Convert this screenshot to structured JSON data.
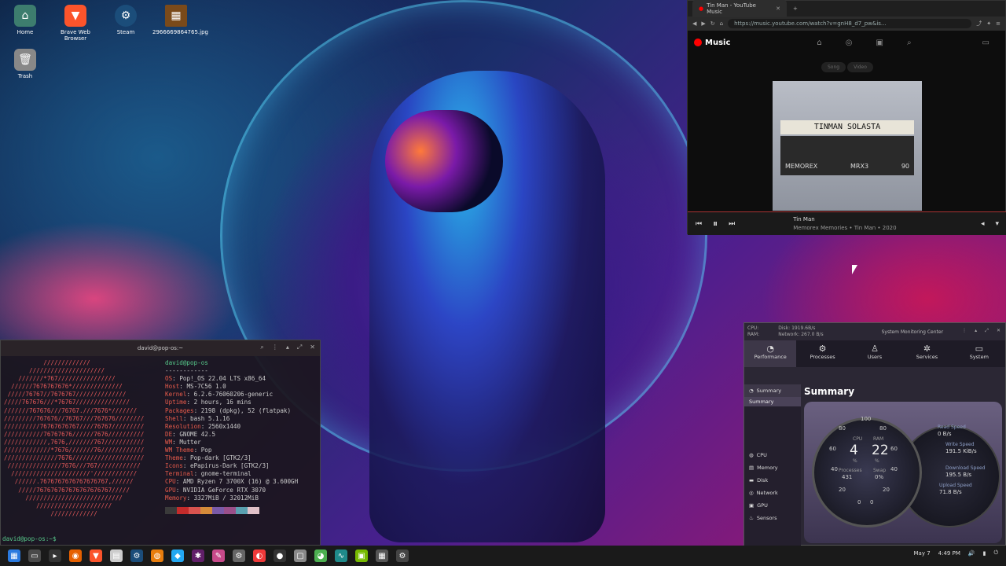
{
  "desktop": {
    "icons": [
      {
        "label": "Home",
        "icon": "folder-home-icon",
        "color": "#3d7d6e"
      },
      {
        "label": "Brave Web Browser",
        "icon": "brave-lion-icon",
        "color": "#fb542b"
      },
      {
        "label": "Steam",
        "icon": "steam-icon",
        "color": "#1b4d7a"
      },
      {
        "label": "2966669864765.jpg",
        "icon": "image-file-icon",
        "color": "#7a4a1a"
      },
      {
        "label": "Trash",
        "icon": "trash-icon",
        "color": "#888888"
      }
    ]
  },
  "music": {
    "tab_title": "Tin Man - YouTube Music",
    "url": "https://music.youtube.com/watch?v=gnH8_d7_pw&is...",
    "brand": "Music",
    "pills": [
      "Song",
      "Video"
    ],
    "cassette_label": "TINMAN SOLASTA",
    "cassette_brand": "MEMOREX",
    "cassette_model": "MRX3",
    "cassette_num": "90",
    "song_title": "Tin Man",
    "song_sub": "Memorex Memories • Tin Man • 2020"
  },
  "terminal": {
    "title": "david@pop-os:~",
    "user": "david@pop-os",
    "sep": "------------",
    "lines": [
      {
        "k": "OS",
        "v": "Pop!_OS 22.04 LTS x86_64"
      },
      {
        "k": "Host",
        "v": "MS-7C56 1.0"
      },
      {
        "k": "Kernel",
        "v": "6.2.6-76060206-generic"
      },
      {
        "k": "Uptime",
        "v": "2 hours, 16 mins"
      },
      {
        "k": "Packages",
        "v": "2198 (dpkg), 52 (flatpak)"
      },
      {
        "k": "Shell",
        "v": "bash 5.1.16"
      },
      {
        "k": "Resolution",
        "v": "2560x1440"
      },
      {
        "k": "DE",
        "v": "GNOME 42.5"
      },
      {
        "k": "WM",
        "v": "Mutter"
      },
      {
        "k": "WM Theme",
        "v": "Pop"
      },
      {
        "k": "Theme",
        "v": "Pop-dark [GTK2/3]"
      },
      {
        "k": "Icons",
        "v": "ePapirus-Dark [GTK2/3]"
      },
      {
        "k": "Terminal",
        "v": "gnome-terminal"
      },
      {
        "k": "CPU",
        "v": "AMD Ryzen 7 3700X (16) @ 3.600GH"
      },
      {
        "k": "GPU",
        "v": "NVIDIA GeForce RTX 3070"
      },
      {
        "k": "Memory",
        "v": "3327MiB / 32012MiB"
      }
    ],
    "ascii": "           /////////////\n       /////////////////////\n    ///////*767////////////////\n  //////7676767676*//////////////\n /////76767//7676767//////////////\n/////767676///*76767///////////////\n///////767676///76767.///7676*///////\n/////////767676//76767///767676////////\n//////////76767676767////76767/////////\n///////////76767676//////7676//////////\n////////////,7676,///////767///////////\n/////////////*7676///////76////////////\n///////////////7676////////////////////\n ///////////////7676///767////////////\n  //////////////////////'////////////\n   //////.7676767676767676767,//////\n    /////767676767676767676767/////\n      ///////////////////////////\n         /////////////////////\n             /////////////",
    "swatches": [
      "#3a3a3a",
      "#c42b2b",
      "#d9534f",
      "#d58b3a",
      "#7a5aa8",
      "#9a4f8a",
      "#5aa0b0",
      "#e0c0c8"
    ],
    "prompt": "david@pop-os:~$ "
  },
  "monitor": {
    "title": "System Monitoring Center",
    "top_stats": [
      "CPU:",
      "RAM:",
      "Disk:",
      "Network:",
      "1919.6B/s",
      "267.0 B/s"
    ],
    "tabs": [
      {
        "label": "Performance",
        "icon": "gauge-icon"
      },
      {
        "label": "Processes",
        "icon": "gear-icon"
      },
      {
        "label": "Users",
        "icon": "user-icon"
      },
      {
        "label": "Services",
        "icon": "services-icon"
      },
      {
        "label": "System",
        "icon": "monitor-icon"
      }
    ],
    "side": {
      "summary": "Summary",
      "summary_sub": "Summary",
      "items": [
        "CPU",
        "Memory",
        "Disk",
        "Network",
        "GPU",
        "Sensors"
      ]
    },
    "heading": "Summary",
    "gauge": {
      "cpu_label": "CPU",
      "cpu_val": "4",
      "ram_label": "RAM",
      "ram_val": "22",
      "pct": "%",
      "proc_label": "Processes",
      "proc_val": "431",
      "swap_label": "Swap",
      "swap_val": "0%",
      "ticks": [
        "100",
        "80",
        "60",
        "40",
        "20",
        "0",
        "100",
        "80",
        "60",
        "40",
        "20",
        "0"
      ],
      "read_label": "Read Speed",
      "read_val": "0 B/s",
      "write_label": "Write Speed",
      "write_val": "191.5 KiB/s",
      "down_label": "Download Speed",
      "down_val": "195.5 B/s",
      "up_label": "Upload Speed",
      "up_val": "71.8 B/s"
    }
  },
  "taskbar": {
    "date": "May 7",
    "time": "4:49 PM",
    "apps": [
      "pop-launcher-icon",
      "files-icon",
      "terminal-icon",
      "firefox-icon",
      "brave-icon",
      "text-editor-icon",
      "steam-icon",
      "blender-icon",
      "vscode-icon",
      "slack-icon",
      "krita-icon",
      "settings-icon",
      "vivaldi-icon",
      "obs-icon",
      "document-icon",
      "chrome-icon",
      "system-monitor-icon",
      "gpu-icon",
      "calculator-icon",
      "gear-icon"
    ]
  }
}
